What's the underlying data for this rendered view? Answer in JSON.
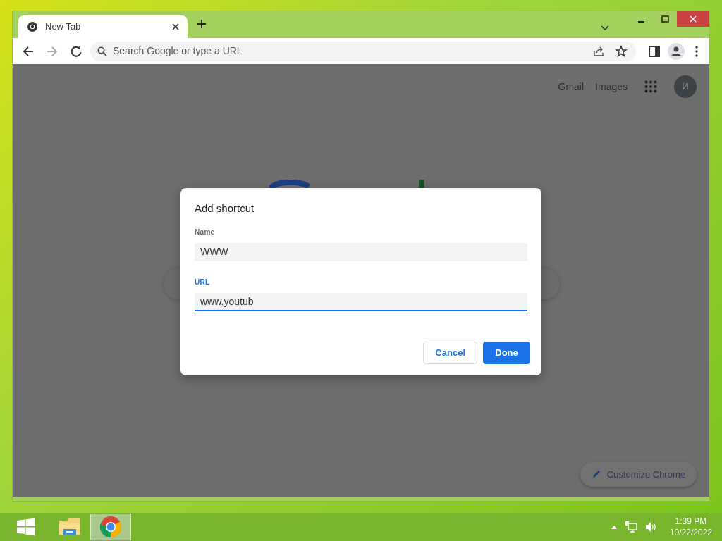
{
  "window": {
    "tab": {
      "title": "New Tab",
      "selected": true
    },
    "address_bar": {
      "placeholder": "Search Google or type a URL"
    }
  },
  "page": {
    "links": [
      "Gmail",
      "Images"
    ],
    "avatar": "И",
    "customize_button": "Customize Chrome"
  },
  "dialog": {
    "title": "Add shortcut",
    "fields": [
      {
        "label": "Name",
        "value": "WWW",
        "focused": false
      },
      {
        "label": "URL",
        "value": "www.youtub",
        "focused": true
      }
    ],
    "buttons": [
      {
        "label": "Cancel",
        "kind": "secondary"
      },
      {
        "label": "Done",
        "kind": "primary"
      }
    ]
  },
  "taskbar": {
    "apps": [
      {
        "kind": "explorer",
        "selected": false
      },
      {
        "kind": "chrome",
        "selected": true
      }
    ],
    "time": "1:39 PM",
    "date": "10/22/2022"
  }
}
